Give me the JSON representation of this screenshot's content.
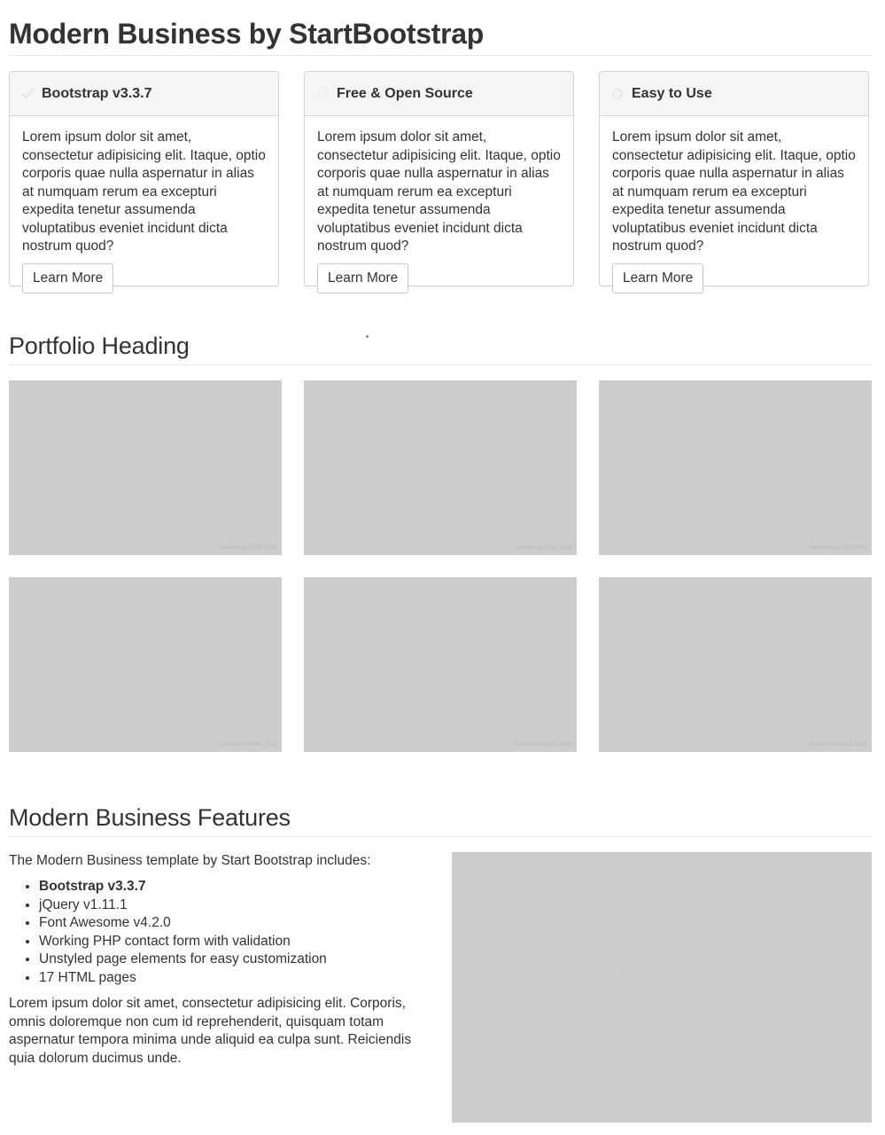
{
  "page": {
    "title": "Modern Business by StartBootstrap"
  },
  "panels": [
    {
      "icon": "check-icon",
      "title": "Bootstrap v3.3.7",
      "body": "Lorem ipsum dolor sit amet, consectetur adipisicing elit. Itaque, optio corporis quae nulla aspernatur in alias at numquam rerum ea excepturi expedita tenetur assumenda voluptatibus eveniet incidunt dicta nostrum quod?",
      "button": "Learn More"
    },
    {
      "icon": "gift-icon",
      "title": "Free & Open Source",
      "body": "Lorem ipsum dolor sit amet, consectetur adipisicing elit. Itaque, optio corporis quae nulla aspernatur in alias at numquam rerum ea excepturi expedita tenetur assumenda voluptatibus eveniet incidunt dicta nostrum quod?",
      "button": "Learn More"
    },
    {
      "icon": "compass-icon",
      "title": "Easy to Use",
      "body": "Lorem ipsum dolor sit amet, consectetur adipisicing elit. Itaque, optio corporis quae nulla aspernatur in alias at numquam rerum ea excepturi expedita tenetur assumenda voluptatibus eveniet incidunt dicta nostrum quod?",
      "button": "Learn More"
    }
  ],
  "portfolio": {
    "heading": "Portfolio Heading",
    "items": [
      {
        "caption": "Powered by HTML.COM"
      },
      {
        "caption": "Powered by HTML.COM"
      },
      {
        "caption": "Powered by HTML.COM"
      },
      {
        "caption": "Powered by HTML.COM"
      },
      {
        "caption": "Powered by HTML.COM"
      },
      {
        "caption": "Powered by HTML.COM"
      }
    ]
  },
  "features": {
    "heading": "Modern Business Features",
    "intro": "The Modern Business template by Start Bootstrap includes:",
    "items": [
      "Bootstrap v3.3.7",
      "jQuery v1.11.1",
      "Font Awesome v4.2.0",
      "Working PHP contact form with validation",
      "Unstyled page elements for easy customization",
      "17 HTML pages"
    ],
    "paragraph": "Lorem ipsum dolor sit amet, consectetur adipisicing elit. Corporis, omnis doloremque non cum id reprehenderit, quisquam totam aspernatur tempora minima unde aliquid ea culpa sunt. Reiciendis quia dolorum ducimus unde."
  },
  "colors": {
    "text": "#333333",
    "panel_heading_bg": "#f5f5f5",
    "panel_border": "#d4d4d4",
    "placeholder_bg": "#cccccc",
    "rule": "#e6e6e6"
  }
}
